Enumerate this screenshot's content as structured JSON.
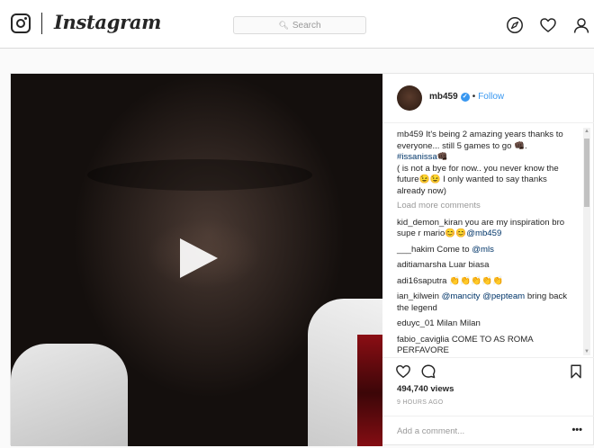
{
  "topbar": {
    "logo_icon": "instagram-camera-icon",
    "wordmark": "Instagram",
    "search_placeholder": "Search",
    "nav_icons": [
      "compass-icon",
      "heart-icon",
      "user-icon"
    ]
  },
  "post": {
    "media_type": "video",
    "username": "mb459",
    "verified": true,
    "separator": "•",
    "follow_label": "Follow",
    "caption": {
      "user": "mb459",
      "text": "It's being 2 amazing years thanks to everyone... still 5 games to go 👊🏿.",
      "hashtag": "#issanissa👊🏿",
      "text2": "( is not a bye for now.. you never know the future😉😉 I only wanted to say thanks already now)"
    },
    "load_more": "Load more comments",
    "comments": [
      {
        "user": "kid_demon_kiran",
        "text": "you are my inspiration bro supe r mario",
        "emoji": "😊😊",
        "mention": "@mb459"
      },
      {
        "user": "___hakim",
        "text": "Come to",
        "mention": "@mls"
      },
      {
        "user": "aditiamarsha",
        "text": "Luar biasa"
      },
      {
        "user": "adi16saputra",
        "text": "👏👏👏👏👏"
      },
      {
        "user": "ian_kilwein",
        "mention": "@mancity",
        "mention2": "@pepteam",
        "text": "bring back the legend"
      },
      {
        "user": "eduyc_01",
        "text": "Milan Milan"
      },
      {
        "user": "fabio_caviglia",
        "text": "COME TO AS ROMA PERFAVORE"
      }
    ],
    "views": "494,740 views",
    "time": "9 HOURS AGO",
    "add_comment_placeholder": "Add a comment...",
    "more_label": "•••"
  },
  "colors": {
    "accent": "#3897f0",
    "text": "#262626",
    "muted": "#999999",
    "border": "#dbdbdb"
  }
}
